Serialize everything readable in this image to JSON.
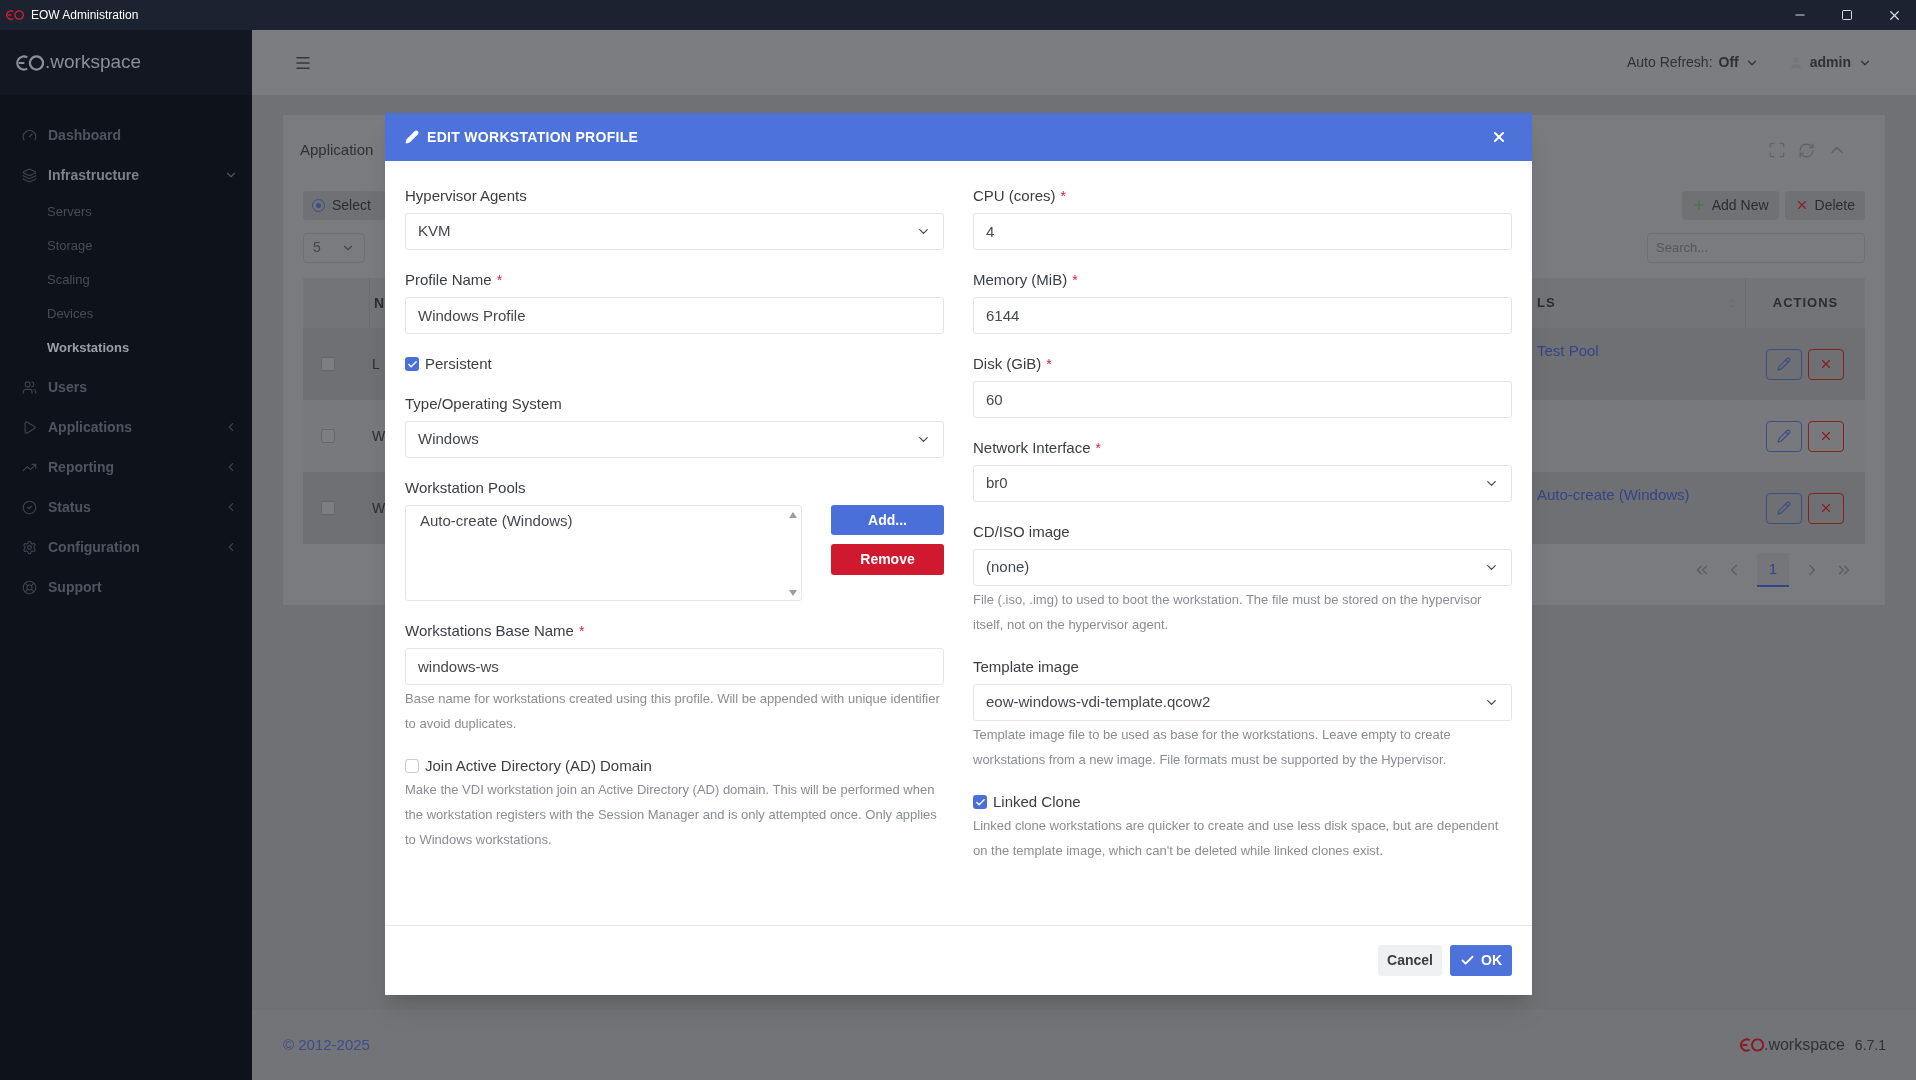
{
  "window": {
    "title": "EOW Administration"
  },
  "sidebar": {
    "logo": ".workspace",
    "items": [
      {
        "label": "Dashboard",
        "selected": false
      },
      {
        "label": "Infrastructure",
        "selected": false,
        "expanded": true,
        "children": [
          {
            "label": "Servers",
            "selected": false
          },
          {
            "label": "Storage",
            "selected": false
          },
          {
            "label": "Scaling",
            "selected": false
          },
          {
            "label": "Devices",
            "selected": false
          },
          {
            "label": "Workstations",
            "selected": true
          }
        ]
      },
      {
        "label": "Users",
        "selected": false
      },
      {
        "label": "Applications",
        "selected": false,
        "expanded": false
      },
      {
        "label": "Reporting",
        "selected": false,
        "expanded": false
      },
      {
        "label": "Status",
        "selected": false,
        "expanded": false
      },
      {
        "label": "Configuration",
        "selected": false,
        "expanded": false
      },
      {
        "label": "Support",
        "selected": false
      }
    ]
  },
  "header": {
    "auto_refresh_label": "Auto Refresh:",
    "auto_refresh_value": "Off",
    "user": "admin"
  },
  "card": {
    "title": "Application",
    "select_button": "Select",
    "add_button": "Add New",
    "delete_button": "Delete",
    "page_size": "5",
    "search_placeholder": "Search...",
    "columns": [
      "N",
      "LS",
      "ACTIONS"
    ],
    "rows": [
      {
        "checked": false,
        "cells": [
          "L",
          "Test Pool"
        ]
      },
      {
        "checked": false,
        "cells": [
          "W",
          ""
        ]
      },
      {
        "checked": false,
        "cells": [
          "W",
          "Auto-create (Windows)"
        ]
      }
    ],
    "pages": [
      {
        "label": "1",
        "selected": true
      }
    ]
  },
  "modal": {
    "title": "EDIT WORKSTATION PROFILE",
    "left": [
      {
        "kind": "select",
        "label": "Hypervisor Agents",
        "value": "KVM"
      },
      {
        "kind": "input",
        "label": "Profile Name",
        "required_mark": "*",
        "value": "Windows Profile"
      },
      {
        "kind": "checkbox",
        "label": "Persistent",
        "checked": true
      },
      {
        "kind": "select",
        "label": "Type/Operating System",
        "value": "Windows"
      },
      {
        "kind": "list",
        "label": "Workstation Pools",
        "items": [
          "Auto-create (Windows)"
        ],
        "add_button": "Add...",
        "remove_button": "Remove"
      },
      {
        "kind": "input",
        "label": "Workstations Base Name",
        "required_mark": "*",
        "value": "windows-ws",
        "help": "Base name for workstations created using this profile. Will be appended with unique identifier to avoid duplicates."
      },
      {
        "kind": "checkbox",
        "label": "Join Active Directory (AD) Domain",
        "checked": false,
        "help": "Make the VDI workstation join an Active Directory (AD) domain. This will be performed when the workstation registers with the Session Manager and is only attempted once. Only applies to Windows workstations."
      }
    ],
    "right": [
      {
        "kind": "input",
        "label": "CPU (cores)",
        "required_mark": "*",
        "value": "4"
      },
      {
        "kind": "input",
        "label": "Memory (MiB)",
        "required_mark": "*",
        "value": "6144"
      },
      {
        "kind": "input",
        "label": "Disk (GiB)",
        "required_mark": "*",
        "value": "60"
      },
      {
        "kind": "select",
        "label": "Network Interface",
        "required_mark": "*",
        "value": "br0"
      },
      {
        "kind": "select",
        "label": "CD/ISO image",
        "value": "(none)",
        "help": "File (.iso, .img) to used to boot the workstation. The file must be stored on the hypervisor itself, not on the hypervisor agent."
      },
      {
        "kind": "select",
        "label": "Template image",
        "value": "eow-windows-vdi-template.qcow2",
        "help": "Template image file to be used as base for the workstations. Leave empty to create workstations from a new image. File formats must be supported by the Hypervisor."
      },
      {
        "kind": "checkbox",
        "label": "Linked Clone",
        "checked": true,
        "help": "Linked clone workstations are quicker to create and use less disk space, but are dependent on the template image, which can't be deleted while linked clones exist."
      }
    ],
    "cancel_button": "Cancel",
    "ok_button": "OK"
  },
  "footer": {
    "copyright": "© 2012-2025",
    "brand": ".workspace",
    "version": "6.7.1"
  }
}
